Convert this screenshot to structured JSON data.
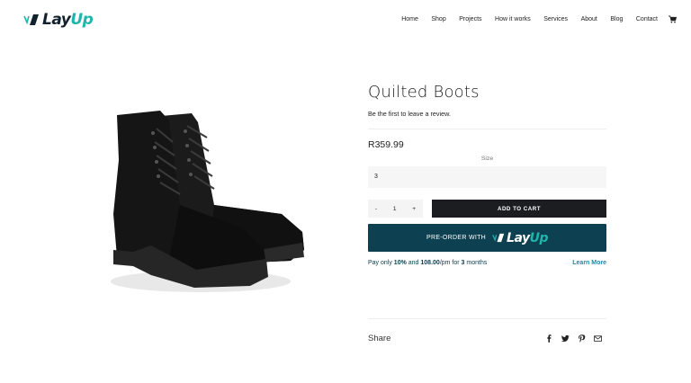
{
  "brand": {
    "name_part1": "Lay",
    "name_part2": "Up",
    "primary_color": "#11212e",
    "accent_color": "#1fb5ab"
  },
  "nav": {
    "items": [
      "Home",
      "Shop",
      "Projects",
      "How it works",
      "Services",
      "About",
      "Blog",
      "Contact"
    ],
    "cart_icon": "cart-icon"
  },
  "product": {
    "image_icon": "boots-image",
    "title": "Quilted Boots",
    "review_text": "Be the first to leave a review.",
    "price": "R359.99",
    "size_label": "Size",
    "size_value": "3",
    "qty_minus": "-",
    "qty_value": "1",
    "qty_plus": "+",
    "add_to_cart": "ADD TO CART",
    "preorder_label": "PRE-ORDER WITH",
    "preorder_color": "#0d4152",
    "payment": {
      "prefix": "Pay only ",
      "percent": "10%",
      "mid1": " and ",
      "amount": "108.00",
      "mid2": "/pm for ",
      "months": "3",
      "suffix": " months"
    },
    "learn_more": "Learn More"
  },
  "share": {
    "label": "Share",
    "icons": [
      "facebook-icon",
      "twitter-icon",
      "pinterest-icon",
      "email-icon"
    ]
  }
}
